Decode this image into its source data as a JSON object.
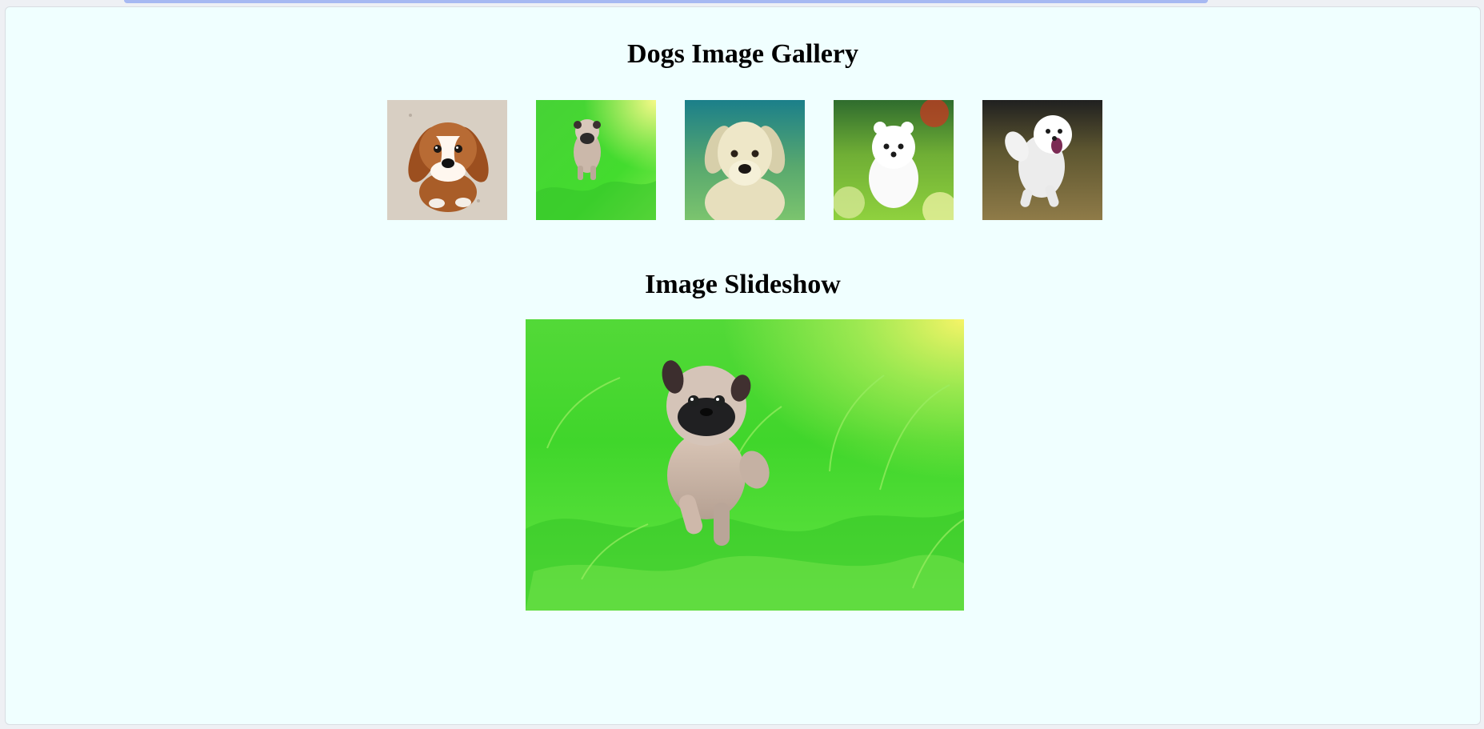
{
  "gallery": {
    "title": "Dogs Image Gallery",
    "images": [
      {
        "name": "beagle-puppy-thumbnail",
        "subject": "brown and white puppy sitting on sand"
      },
      {
        "name": "pug-puppy-thumbnail",
        "subject": "pug puppy walking on green grass"
      },
      {
        "name": "labrador-puppy-thumbnail",
        "subject": "cream labrador puppy on teal background"
      },
      {
        "name": "pomeranian-puppy-thumbnail",
        "subject": "white fluffy puppy sitting in grass"
      },
      {
        "name": "maltese-puppy-thumbnail",
        "subject": "white puppy running on grass"
      }
    ]
  },
  "slideshow": {
    "title": "Image Slideshow",
    "current_image": "pug puppy walking on green grass"
  },
  "colors": {
    "page_background": "#f0ffff",
    "top_strip": "#a7b9f2",
    "text": "#000000"
  }
}
